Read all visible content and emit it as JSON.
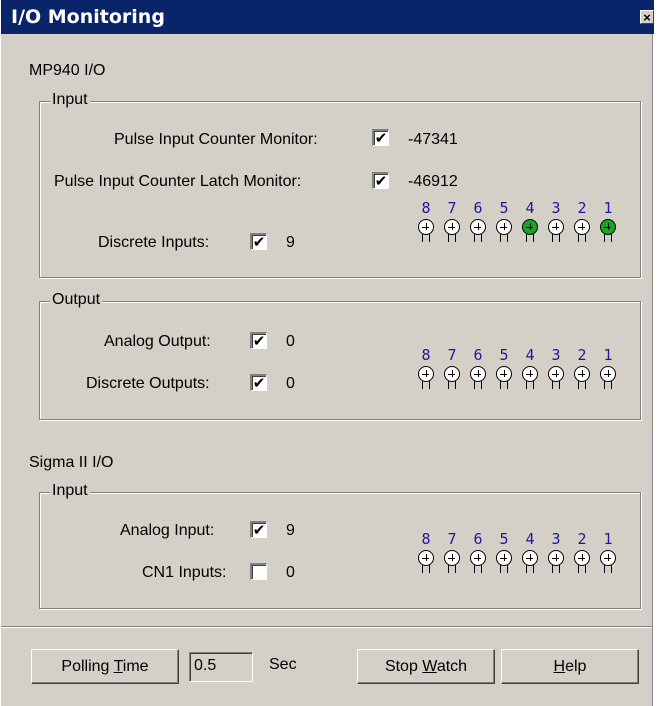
{
  "window": {
    "title": "I/O Monitoring",
    "close": "×"
  },
  "mp940": {
    "heading": "MP940 I/O",
    "input": {
      "legend": "Input",
      "pulse_counter": {
        "label": "Pulse Input Counter Monitor:",
        "checked": true,
        "value": "-47341"
      },
      "pulse_latch": {
        "label": "Pulse Input Counter Latch Monitor:",
        "checked": true,
        "value": "-46912"
      },
      "discrete": {
        "label": "Discrete Inputs:",
        "checked": true,
        "value": "9"
      },
      "bits": [
        "8",
        "7",
        "6",
        "5",
        "4",
        "3",
        "2",
        "1"
      ],
      "bit_states": [
        false,
        false,
        false,
        false,
        true,
        false,
        false,
        true
      ]
    },
    "output": {
      "legend": "Output",
      "analog": {
        "label": "Analog Output:",
        "checked": true,
        "value": "0"
      },
      "discrete": {
        "label": "Discrete Outputs:",
        "checked": true,
        "value": "0"
      },
      "bits": [
        "8",
        "7",
        "6",
        "5",
        "4",
        "3",
        "2",
        "1"
      ],
      "bit_states": [
        false,
        false,
        false,
        false,
        false,
        false,
        false,
        false
      ]
    }
  },
  "sigma": {
    "heading": "Sigma II I/O",
    "input": {
      "legend": "Input",
      "analog": {
        "label": "Analog Input:",
        "checked": true,
        "value": "9"
      },
      "cn1": {
        "label": "CN1 Inputs:",
        "checked": false,
        "value": "0"
      },
      "bits": [
        "8",
        "7",
        "6",
        "5",
        "4",
        "3",
        "2",
        "1"
      ],
      "bit_states": [
        false,
        false,
        false,
        false,
        false,
        false,
        false,
        false
      ]
    }
  },
  "footer": {
    "polling_pre": "Polling ",
    "polling_mn": "T",
    "polling_post": "ime",
    "polling_value": "0.5",
    "sec": "Sec",
    "stop_pre": "Stop ",
    "stop_mn": "W",
    "stop_post": "atch",
    "help_mn": "H",
    "help_post": "elp"
  },
  "colors": {
    "led_on": "#1aa52a",
    "bit_number": "#1a1a9a",
    "titlebar": "#0a246a"
  }
}
